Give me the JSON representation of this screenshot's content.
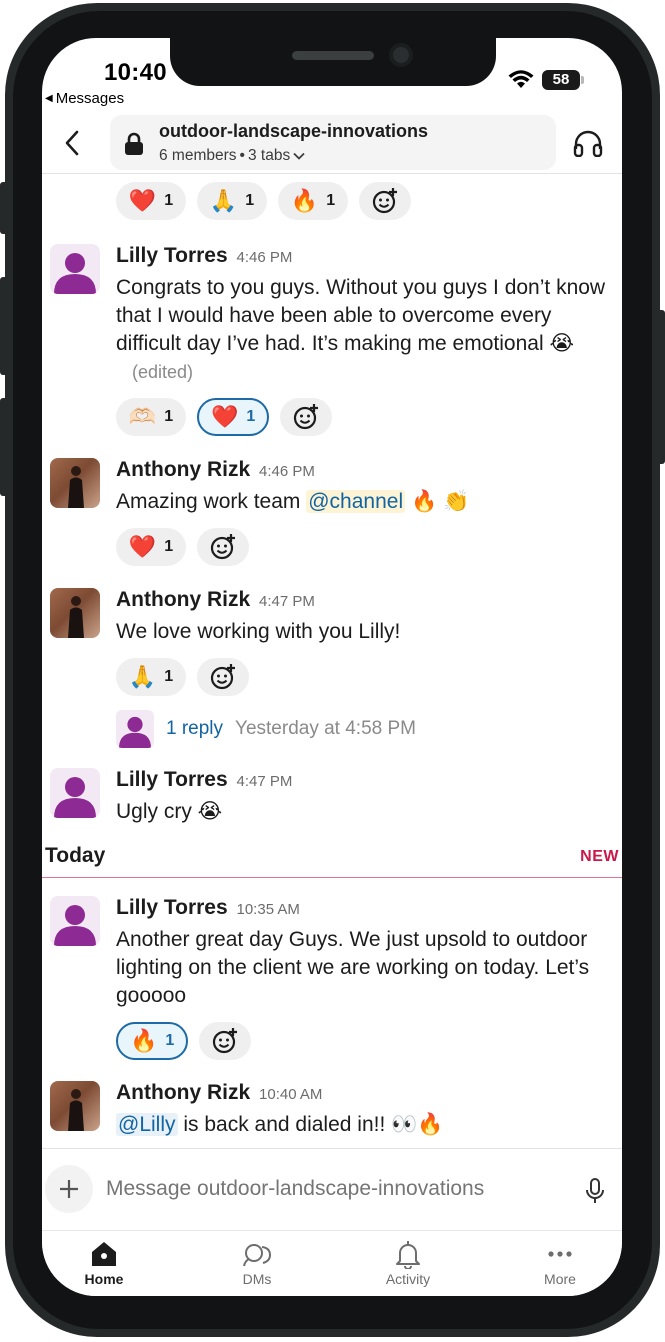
{
  "status": {
    "time": "10:40",
    "back_app": "Messages",
    "battery": "58"
  },
  "header": {
    "channel_name": "outdoor-landscape-innovations",
    "members": "6 members",
    "tabs": "3 tabs"
  },
  "top_reactions": [
    {
      "emoji": "❤️",
      "count": "1"
    },
    {
      "emoji": "🙏",
      "count": "1"
    },
    {
      "emoji": "🔥",
      "count": "1"
    }
  ],
  "messages": [
    {
      "sender": "Lilly Torres",
      "time": "4:46 PM",
      "text": "Congrats to you guys. Without you guys I don’t know that I would have been able to overcome every difficult day I’ve had. It’s making me emotional 😭",
      "edited": "(edited)",
      "reactions": [
        {
          "emoji": "🫶🏻",
          "count": "1"
        },
        {
          "emoji": "❤️",
          "count": "1"
        }
      ]
    },
    {
      "sender": "Anthony Rizk",
      "time": "4:46 PM",
      "text_before": "Amazing work team ",
      "mention": "@channel",
      "text_after": " 🔥 👏",
      "reactions": [
        {
          "emoji": "❤️",
          "count": "1"
        }
      ]
    },
    {
      "sender": "Anthony Rizk",
      "time": "4:47 PM",
      "text": "We love working with you Lilly!",
      "reactions": [
        {
          "emoji": "🙏",
          "count": "1"
        }
      ],
      "thread": {
        "reply": "1 reply",
        "time": "Yesterday at 4:58 PM"
      }
    },
    {
      "sender": "Lilly Torres",
      "time": "4:47 PM",
      "text": "Ugly cry 😭"
    },
    {
      "sender": "Lilly Torres",
      "time": "10:35 AM",
      "text": "Another great day Guys. We just upsold to outdoor lighting on the client we are working on today. Let’s gooooo",
      "reactions": [
        {
          "emoji": "🔥",
          "count": "1"
        }
      ]
    },
    {
      "sender": "Anthony Rizk",
      "time": "10:40 AM",
      "mention": "@Lilly",
      "text_after": " is back and dialed in!! 👀🔥"
    }
  ],
  "divider": {
    "label": "Today",
    "new": "NEW"
  },
  "composer": {
    "placeholder": "Message outdoor-landscape-innovations"
  },
  "tabbar": {
    "home": "Home",
    "dms": "DMs",
    "activity": "Activity",
    "more": "More"
  }
}
